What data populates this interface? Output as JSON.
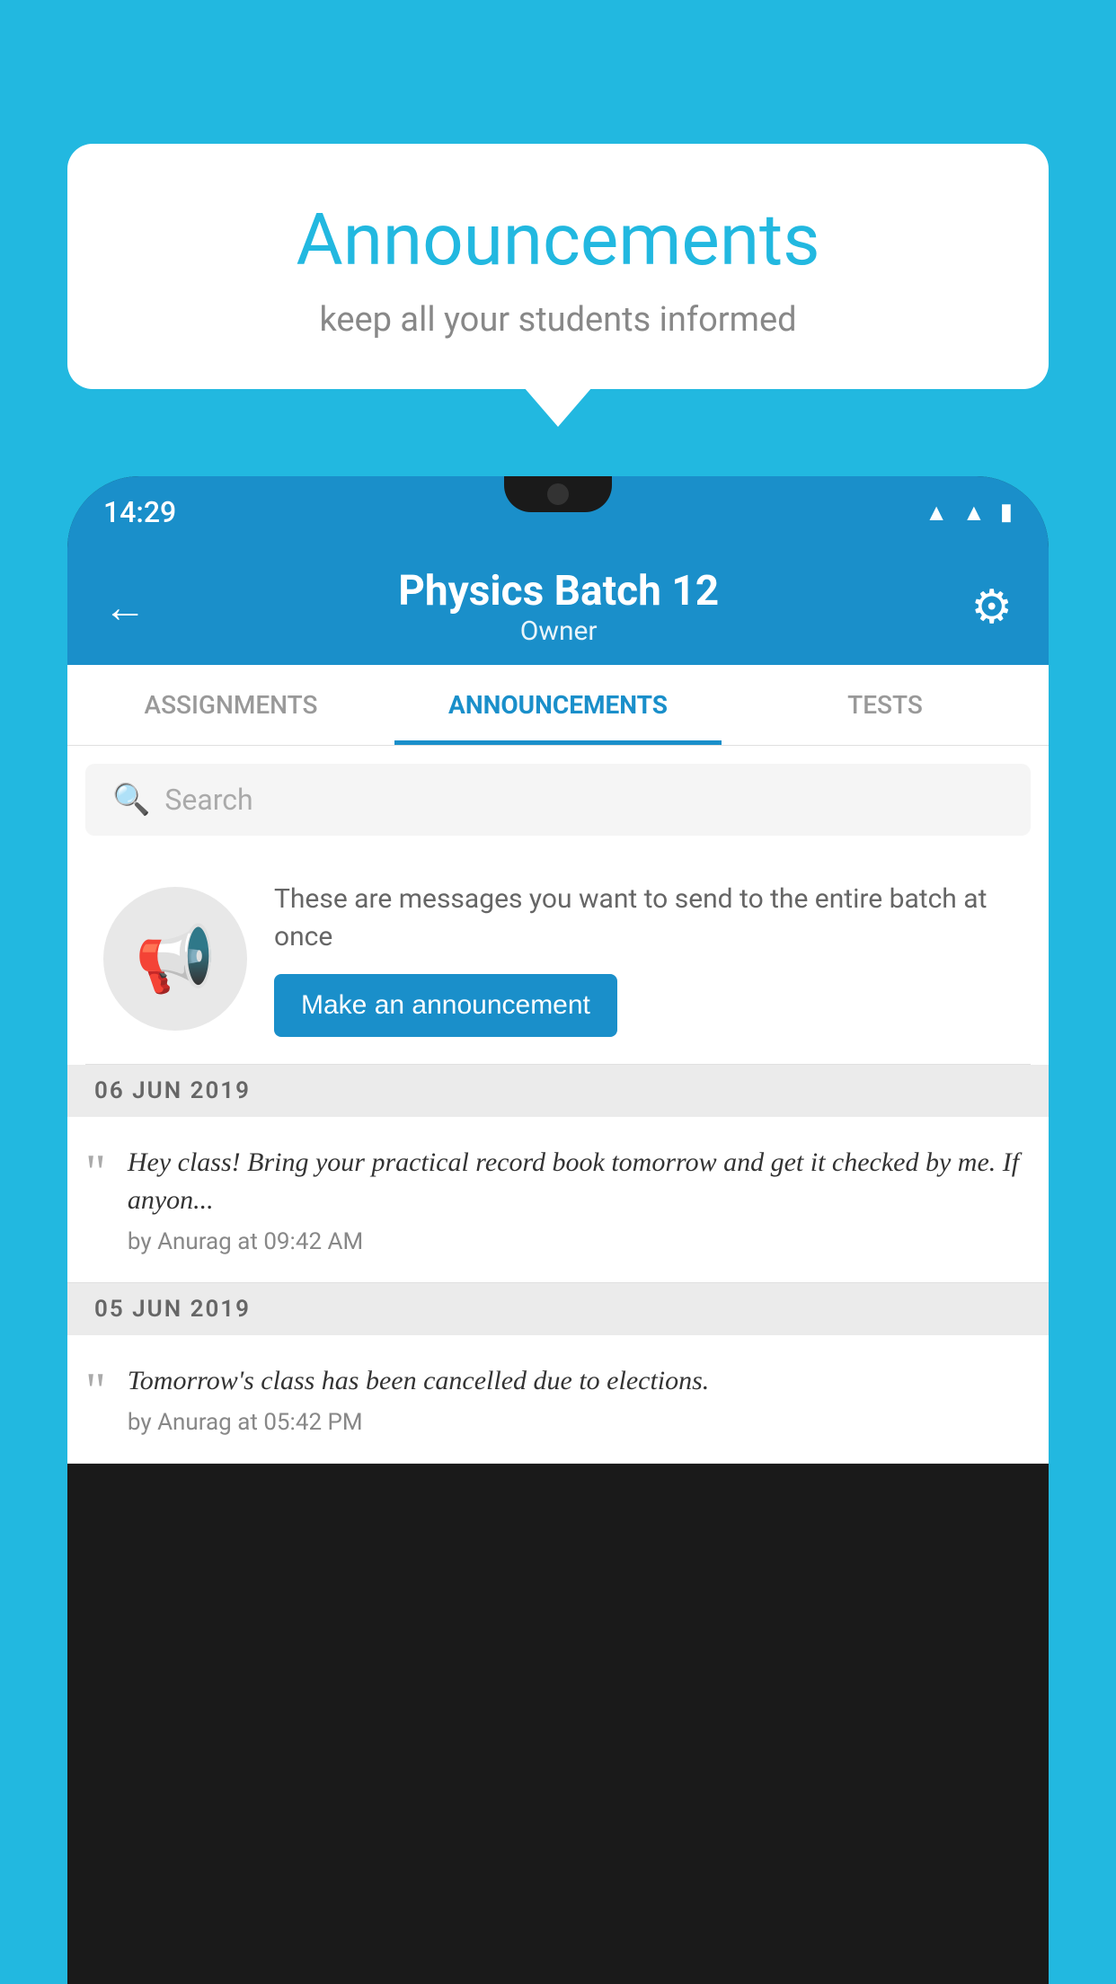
{
  "background_color": "#22b8e0",
  "speech_bubble": {
    "title": "Announcements",
    "subtitle": "keep all your students informed"
  },
  "phone": {
    "status_bar": {
      "time": "14:29"
    },
    "header": {
      "title": "Physics Batch 12",
      "subtitle": "Owner",
      "back_label": "←"
    },
    "tabs": [
      {
        "label": "ASSIGNMENTS",
        "active": false
      },
      {
        "label": "ANNOUNCEMENTS",
        "active": true
      },
      {
        "label": "TESTS",
        "active": false
      }
    ],
    "search": {
      "placeholder": "Search"
    },
    "promo": {
      "description": "These are messages you want to send to the entire batch at once",
      "button_label": "Make an announcement"
    },
    "announcements": [
      {
        "date": "06  JUN  2019",
        "message": "Hey class! Bring your practical record book tomorrow and get it checked by me. If anyon...",
        "author": "by Anurag at 09:42 AM"
      },
      {
        "date": "05  JUN  2019",
        "message": "Tomorrow's class has been cancelled due to elections.",
        "author": "by Anurag at 05:42 PM"
      }
    ]
  }
}
